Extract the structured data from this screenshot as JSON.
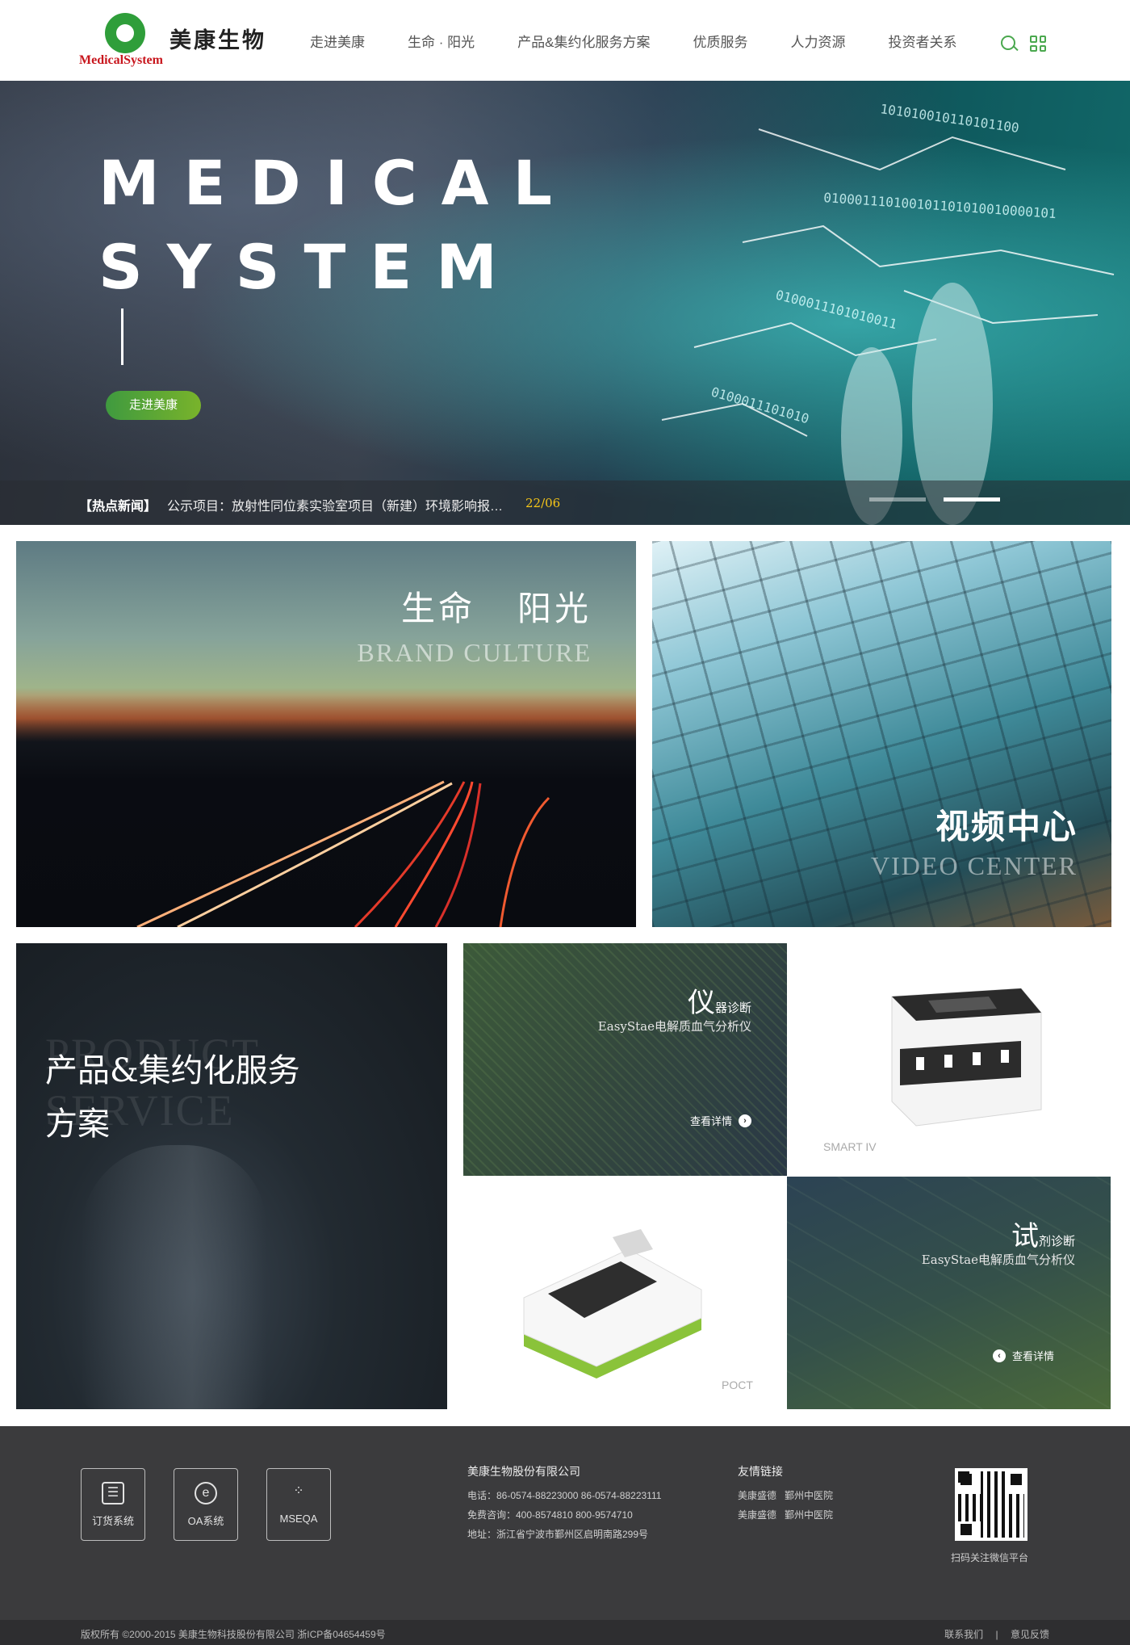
{
  "header": {
    "logo_cn": "美康生物",
    "logo_en": "MedicalSystem",
    "nav": [
      "走进美康",
      "生命 · 阳光",
      "产品&集约化服务方案",
      "优质服务",
      "人力资源",
      "投资者关系"
    ]
  },
  "hero": {
    "title_line1": "MEDICAL",
    "title_line2": "SYSTEM",
    "button_label": "走进美康",
    "news_tag": "【热点新闻】",
    "news_text": "公示项目：放射性同位素实验室项目（新建）环境影响报…",
    "news_date": "22/06",
    "slide_count": 2,
    "active_slide": 2
  },
  "tiles": {
    "life_cn": "生命   阳光",
    "life_en": "BRAND CULTURE",
    "video_cn": "视频中心",
    "video_en": "VIDEO CENTER",
    "product_ghost": "PRODUCT SERVICE",
    "product_cn": "产品&集约化服务方案",
    "instrument_big": "仪",
    "instrument_small": "器诊断",
    "instrument_sub": "EasyStae电解质血气分析仪",
    "instrument_detail": "查看详情",
    "smart_label": "SMART IV",
    "poct_label": "POCT",
    "reagent_big": "试",
    "reagent_small": "剂诊断",
    "reagent_sub": "EasyStae电解质血气分析仪",
    "reagent_detail": "查看详情"
  },
  "footer": {
    "systems": [
      {
        "label": "订货系统",
        "sym": "☰"
      },
      {
        "label": "OA系统",
        "sym": "e"
      },
      {
        "label": "MSEQA",
        "sym": "⁘"
      }
    ],
    "company": "美康生物股份有限公司",
    "phone": "电话：86-0574-88223000  86-0574-88223111",
    "hotline": "免费咨询：400-8574810  800-9574710",
    "address": "地址：浙江省宁波市鄞州区启明南路299号",
    "links_title": "友情链接",
    "links": [
      [
        "美康盛德",
        "鄞州中医院"
      ],
      [
        "美康盛德",
        "鄞州中医院"
      ]
    ],
    "qr_label": "扫码关注微信平台",
    "copyright": "版权所有 ©2000-2015  美康生物科技股份有限公司  浙ICP备04654459号",
    "contact": "联系我们",
    "sep": "|",
    "feedback": "意见反馈"
  }
}
